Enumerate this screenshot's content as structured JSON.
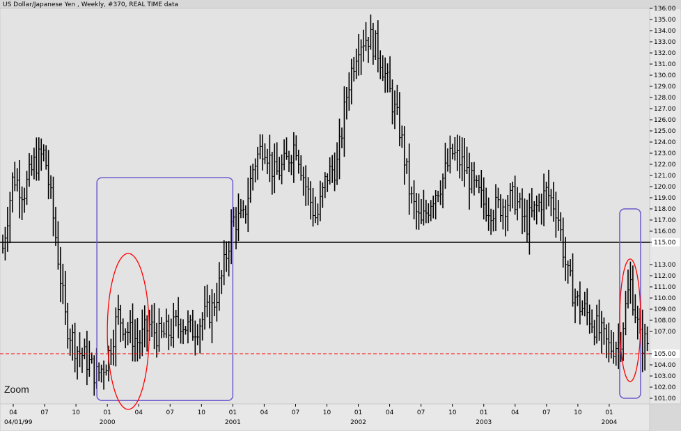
{
  "header": {
    "title": "US Dollar/Japanese Yen , Weekly, #370, REAL TIME data"
  },
  "zoom_label": "Zoom",
  "colors": {
    "background": "#e3e3e3",
    "frame": "#d0d0d0",
    "bars": "#000000",
    "support_line": "#ff0000",
    "pivot_line": "#000000",
    "zoom_box": "#6a5acd",
    "circle": "#ff0000"
  },
  "chart_data": {
    "type": "ohlc",
    "title": "US Dollar/Japanese Yen , Weekly, #370, REAL TIME data",
    "ylim": [
      100.5,
      136.0
    ],
    "y_tick_labels": [
      "101.00",
      "102.00",
      "103.00",
      "104.00",
      "105.00",
      "107.00",
      "108.00",
      "109.00",
      "110.00",
      "111.00",
      "112.00",
      "113.00",
      "115.00",
      "116.00",
      "117.00",
      "118.00",
      "119.00",
      "120.00",
      "121.00",
      "122.00",
      "123.00",
      "124.00",
      "125.00",
      "126.00",
      "127.00",
      "128.00",
      "129.00",
      "130.00",
      "131.00",
      "132.00",
      "133.00",
      "134.00",
      "135.00",
      "136.00"
    ],
    "x_tick_labels": [
      {
        "label": "04",
        "date": "1999-04"
      },
      {
        "label": "07",
        "date": "1999-07"
      },
      {
        "label": "10",
        "date": "1999-10"
      },
      {
        "label": "01",
        "date": "2000-01"
      },
      {
        "label": "04",
        "date": "2000-04"
      },
      {
        "label": "07",
        "date": "2000-07"
      },
      {
        "label": "10",
        "date": "2000-10"
      },
      {
        "label": "01",
        "date": "2001-01"
      },
      {
        "label": "04",
        "date": "2001-04"
      },
      {
        "label": "07",
        "date": "2001-07"
      },
      {
        "label": "10",
        "date": "2001-10"
      },
      {
        "label": "01",
        "date": "2002-01"
      },
      {
        "label": "04",
        "date": "2002-04"
      },
      {
        "label": "07",
        "date": "2002-07"
      },
      {
        "label": "10",
        "date": "2002-10"
      },
      {
        "label": "01",
        "date": "2003-01"
      },
      {
        "label": "04",
        "date": "2003-04"
      },
      {
        "label": "07",
        "date": "2003-07"
      },
      {
        "label": "10",
        "date": "2003-10"
      },
      {
        "label": "01",
        "date": "2004-01"
      }
    ],
    "x_year_labels": [
      {
        "label": "04/01/99",
        "date": "1999-04"
      },
      {
        "label": "2000",
        "date": "2000-01"
      },
      {
        "label": "2001",
        "date": "2001-01"
      },
      {
        "label": "2002",
        "date": "2002-01"
      },
      {
        "label": "2003",
        "date": "2003-01"
      },
      {
        "label": "2004",
        "date": "2004-01"
      }
    ],
    "x_range": [
      "1999-03",
      "2004-04"
    ],
    "pivot_line": {
      "value": 115.0,
      "label": "115.00"
    },
    "support_line": {
      "value": 105.0,
      "label": "105.00"
    },
    "close_path": [
      [
        "1999-03",
        114.5
      ],
      [
        "1999-04",
        121.0
      ],
      [
        "1999-05",
        119.5
      ],
      [
        "1999-06",
        122.0
      ],
      [
        "1999-07",
        123.0
      ],
      [
        "1999-08",
        116.0
      ],
      [
        "1999-09",
        108.0
      ],
      [
        "1999-10",
        105.5
      ],
      [
        "1999-11",
        104.5
      ],
      [
        "1999-12",
        103.0
      ],
      [
        "2000-01",
        104.5
      ],
      [
        "2000-02",
        108.5
      ],
      [
        "2000-03",
        107.0
      ],
      [
        "2000-04",
        106.0
      ],
      [
        "2000-05",
        107.5
      ],
      [
        "2000-06",
        106.5
      ],
      [
        "2000-07",
        107.0
      ],
      [
        "2000-08",
        108.0
      ],
      [
        "2000-09",
        107.0
      ],
      [
        "2000-10",
        108.0
      ],
      [
        "2000-11",
        109.0
      ],
      [
        "2000-12",
        112.0
      ],
      [
        "2001-01",
        117.0
      ],
      [
        "2001-02",
        117.0
      ],
      [
        "2001-03",
        122.0
      ],
      [
        "2001-04",
        124.0
      ],
      [
        "2001-05",
        121.0
      ],
      [
        "2001-06",
        122.0
      ],
      [
        "2001-07",
        124.0
      ],
      [
        "2001-08",
        120.0
      ],
      [
        "2001-09",
        117.0
      ],
      [
        "2001-10",
        121.0
      ],
      [
        "2001-11",
        122.0
      ],
      [
        "2001-12",
        129.0
      ],
      [
        "2002-01",
        133.0
      ],
      [
        "2002-02",
        133.5
      ],
      [
        "2002-03",
        132.0
      ],
      [
        "2002-04",
        128.5
      ],
      [
        "2002-05",
        125.0
      ],
      [
        "2002-06",
        119.0
      ],
      [
        "2002-07",
        116.5
      ],
      [
        "2002-08",
        119.0
      ],
      [
        "2002-09",
        120.5
      ],
      [
        "2002-10",
        123.0
      ],
      [
        "2002-11",
        122.0
      ],
      [
        "2002-12",
        120.0
      ],
      [
        "2003-01",
        118.5
      ],
      [
        "2003-02",
        118.0
      ],
      [
        "2003-03",
        118.5
      ],
      [
        "2003-04",
        119.0
      ],
      [
        "2003-05",
        116.5
      ],
      [
        "2003-06",
        118.0
      ],
      [
        "2003-07",
        119.5
      ],
      [
        "2003-08",
        118.0
      ],
      [
        "2003-09",
        112.0
      ],
      [
        "2003-10",
        109.5
      ],
      [
        "2003-11",
        108.5
      ],
      [
        "2003-12",
        107.0
      ],
      [
        "2004-01",
        105.5
      ],
      [
        "2004-02",
        106.0
      ],
      [
        "2004-03",
        111.5
      ],
      [
        "2004-04",
        106.0
      ]
    ],
    "zoom_boxes": [
      {
        "x_from": "1999-12",
        "x_to": "2001-01",
        "y_from": 100.8,
        "y_to": 120.8
      },
      {
        "x_from": "2004-02",
        "x_to": "2004-04",
        "y_from": 101.0,
        "y_to": 118.0
      }
    ],
    "circles": [
      {
        "x_from": "2000-01",
        "x_to": "2000-05",
        "y_from": 100.0,
        "y_to": 114.0
      },
      {
        "x_from": "2004-02",
        "x_to": "2004-04",
        "y_from": 102.5,
        "y_to": 113.5
      }
    ],
    "grid": false
  }
}
